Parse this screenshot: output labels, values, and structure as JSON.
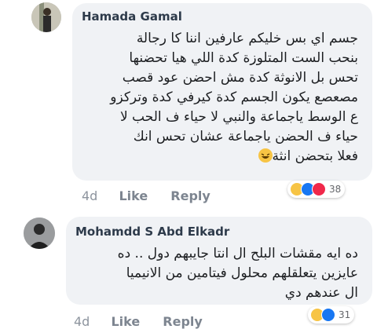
{
  "comments": [
    {
      "author": "Hamada Gamal",
      "lines": [
        "جسم اي بس خليكم عارفين اننا كا رجالة",
        "بنحب الست المتلوزة كدة اللي هيا تحضنها",
        "تحس بل الانوثة كدة مش احضن عود قصب",
        "مصعصع يكون الجسم كدة كيرفي كدة وتركزو",
        "ع الوسط ياجماعة والنبي لا حياء ف الحب لا",
        "حياء ف الحضن ياجماعة عشان تحس انك",
        "فعلا بتحضن انثة"
      ],
      "age": "4d",
      "like_label": "Like",
      "reply_label": "Reply",
      "reaction_count": "38"
    },
    {
      "author": "Mohamdd S Abd Elkadr",
      "lines": [
        "ده ايه مقشات البلح ال انتا جايبهم دول .. ده",
        "عايزين يتعلقلهم محلول فيتامين من الانيميا",
        "ال عندهم دي"
      ],
      "age": "4d",
      "like_label": "Like",
      "reply_label": "Reply",
      "reaction_count": "31"
    }
  ],
  "icons": {
    "inline_emoji": "laughing-emoji-icon",
    "reactions": [
      "haha-reaction-icon",
      "like-reaction-icon",
      "love-reaction-icon"
    ]
  },
  "colors": {
    "bubble": "#f0f2f5",
    "name": "#2d3a4a",
    "like_blue": "#1877f2",
    "love_red": "#f0284a",
    "haha_yellow": "#f7c444"
  }
}
